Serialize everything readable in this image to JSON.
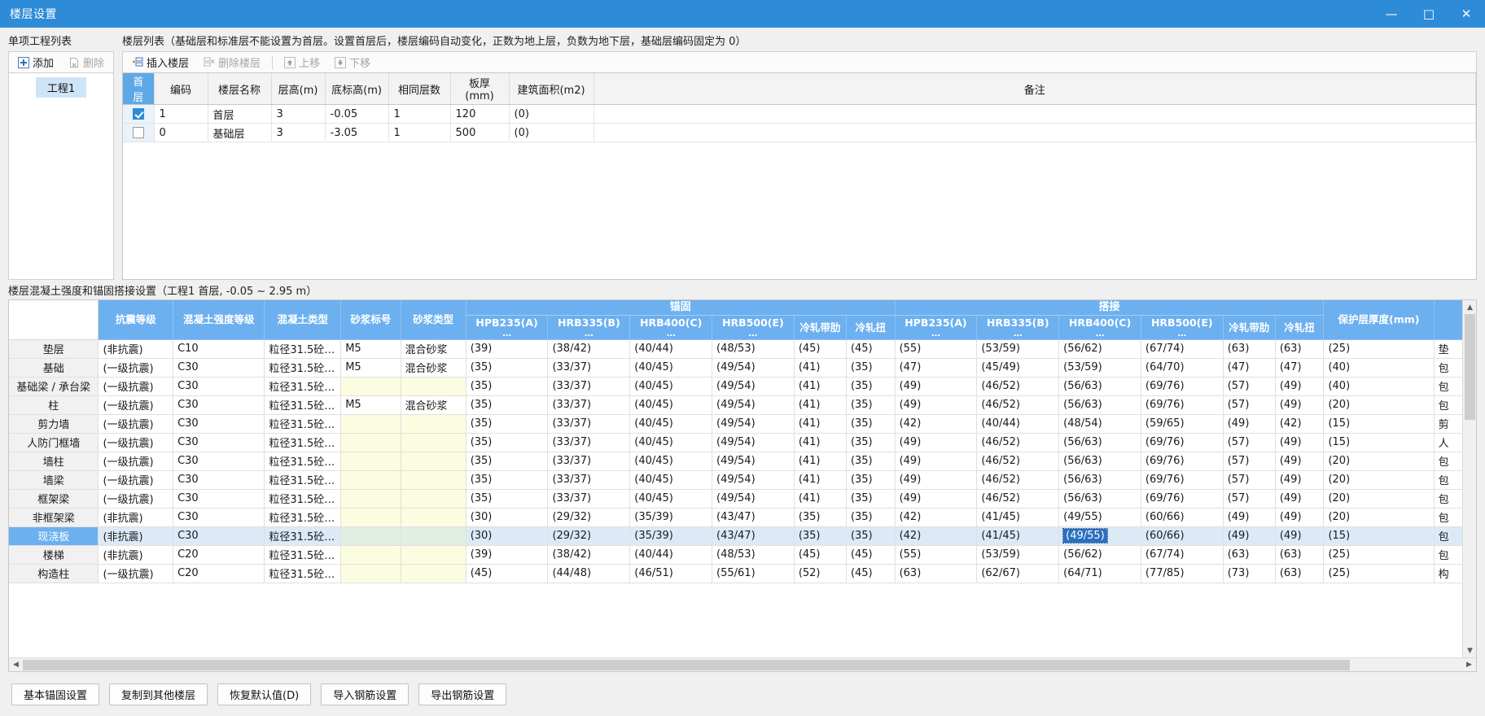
{
  "window": {
    "title": "楼层设置",
    "minimize": "—",
    "maximize": "□",
    "close": "✕"
  },
  "left_panel": {
    "label": "单项工程列表",
    "toolbar": {
      "add": "添加",
      "delete": "删除"
    },
    "items": [
      "工程1"
    ]
  },
  "floor_panel": {
    "label": "楼层列表（基础层和标准层不能设置为首层。设置首层后，楼层编码自动变化，正数为地上层，负数为地下层，基础层编码固定为 0）",
    "toolbar": {
      "insert": "插入楼层",
      "delete": "删除楼层",
      "move_up": "上移",
      "move_down": "下移"
    },
    "columns": [
      "首层",
      "编码",
      "楼层名称",
      "层高(m)",
      "底标高(m)",
      "相同层数",
      "板厚(mm)",
      "建筑面积(m2)",
      "备注"
    ],
    "rows": [
      {
        "checked": true,
        "code": "1",
        "name": "首层",
        "height": "3",
        "base_elev": "-0.05",
        "same_count": "1",
        "slab": "120",
        "area": "(0)",
        "note": ""
      },
      {
        "checked": false,
        "code": "0",
        "name": "基础层",
        "height": "3",
        "base_elev": "-3.05",
        "same_count": "1",
        "slab": "500",
        "area": "(0)",
        "note": ""
      }
    ]
  },
  "concrete_panel": {
    "label": "楼层混凝土强度和锚固搭接设置（工程1  首层, -0.05 ~ 2.95 m）",
    "group_headers": {
      "anchor": "锚固",
      "lap": "搭接"
    },
    "columns": [
      "抗震等级",
      "混凝土强度等级",
      "混凝土类型",
      "砂浆标号",
      "砂浆类型",
      "HPB235(A)\n…",
      "HRB335(B)\n…",
      "HRB400(C)\n…",
      "HRB500(E)\n…",
      "冷轧带肋",
      "冷轧扭",
      "HPB235(A)\n…",
      "HRB335(B)\n…",
      "HRB400(C)\n…",
      "HRB500(E)\n…",
      "冷轧带肋",
      "冷轧扭",
      "保护层厚度(mm)"
    ],
    "column_sub": "…",
    "rows": [
      {
        "name": "垫层",
        "seismic": "(非抗震)",
        "grade": "C10",
        "ctype": "粒径31.5砼…",
        "mortar_no": "M5",
        "mortar_type": "混合砂浆",
        "a": [
          "(39)",
          "(38/42)",
          "(40/44)",
          "(48/53)",
          "(45)",
          "(45)"
        ],
        "l": [
          "(55)",
          "(53/59)",
          "(56/62)",
          "(67/74)",
          "(63)",
          "(63)"
        ],
        "cover": "(25)",
        "last": "垫"
      },
      {
        "name": "基础",
        "seismic": "(一级抗震)",
        "grade": "C30",
        "ctype": "粒径31.5砼…",
        "mortar_no": "M5",
        "mortar_type": "混合砂浆",
        "a": [
          "(35)",
          "(33/37)",
          "(40/45)",
          "(49/54)",
          "(41)",
          "(35)"
        ],
        "l": [
          "(47)",
          "(45/49)",
          "(53/59)",
          "(64/70)",
          "(47)",
          "(47)"
        ],
        "cover": "(40)",
        "last": "包"
      },
      {
        "name": "基础梁 / 承台梁",
        "seismic": "(一级抗震)",
        "grade": "C30",
        "ctype": "粒径31.5砼…",
        "mortar_no": "",
        "mortar_type": "",
        "a": [
          "(35)",
          "(33/37)",
          "(40/45)",
          "(49/54)",
          "(41)",
          "(35)"
        ],
        "l": [
          "(49)",
          "(46/52)",
          "(56/63)",
          "(69/76)",
          "(57)",
          "(49)"
        ],
        "cover": "(40)",
        "last": "包"
      },
      {
        "name": "柱",
        "seismic": "(一级抗震)",
        "grade": "C30",
        "ctype": "粒径31.5砼…",
        "mortar_no": "M5",
        "mortar_type": "混合砂浆",
        "a": [
          "(35)",
          "(33/37)",
          "(40/45)",
          "(49/54)",
          "(41)",
          "(35)"
        ],
        "l": [
          "(49)",
          "(46/52)",
          "(56/63)",
          "(69/76)",
          "(57)",
          "(49)"
        ],
        "cover": "(20)",
        "last": "包"
      },
      {
        "name": "剪力墙",
        "seismic": "(一级抗震)",
        "grade": "C30",
        "ctype": "粒径31.5砼…",
        "mortar_no": "",
        "mortar_type": "",
        "a": [
          "(35)",
          "(33/37)",
          "(40/45)",
          "(49/54)",
          "(41)",
          "(35)"
        ],
        "l": [
          "(42)",
          "(40/44)",
          "(48/54)",
          "(59/65)",
          "(49)",
          "(42)"
        ],
        "cover": "(15)",
        "last": "剪"
      },
      {
        "name": "人防门框墙",
        "seismic": "(一级抗震)",
        "grade": "C30",
        "ctype": "粒径31.5砼…",
        "mortar_no": "",
        "mortar_type": "",
        "a": [
          "(35)",
          "(33/37)",
          "(40/45)",
          "(49/54)",
          "(41)",
          "(35)"
        ],
        "l": [
          "(49)",
          "(46/52)",
          "(56/63)",
          "(69/76)",
          "(57)",
          "(49)"
        ],
        "cover": "(15)",
        "last": "人"
      },
      {
        "name": "墙柱",
        "seismic": "(一级抗震)",
        "grade": "C30",
        "ctype": "粒径31.5砼…",
        "mortar_no": "",
        "mortar_type": "",
        "a": [
          "(35)",
          "(33/37)",
          "(40/45)",
          "(49/54)",
          "(41)",
          "(35)"
        ],
        "l": [
          "(49)",
          "(46/52)",
          "(56/63)",
          "(69/76)",
          "(57)",
          "(49)"
        ],
        "cover": "(20)",
        "last": "包"
      },
      {
        "name": "墙梁",
        "seismic": "(一级抗震)",
        "grade": "C30",
        "ctype": "粒径31.5砼…",
        "mortar_no": "",
        "mortar_type": "",
        "a": [
          "(35)",
          "(33/37)",
          "(40/45)",
          "(49/54)",
          "(41)",
          "(35)"
        ],
        "l": [
          "(49)",
          "(46/52)",
          "(56/63)",
          "(69/76)",
          "(57)",
          "(49)"
        ],
        "cover": "(20)",
        "last": "包"
      },
      {
        "name": "框架梁",
        "seismic": "(一级抗震)",
        "grade": "C30",
        "ctype": "粒径31.5砼…",
        "mortar_no": "",
        "mortar_type": "",
        "a": [
          "(35)",
          "(33/37)",
          "(40/45)",
          "(49/54)",
          "(41)",
          "(35)"
        ],
        "l": [
          "(49)",
          "(46/52)",
          "(56/63)",
          "(69/76)",
          "(57)",
          "(49)"
        ],
        "cover": "(20)",
        "last": "包"
      },
      {
        "name": "非框架梁",
        "seismic": "(非抗震)",
        "grade": "C30",
        "ctype": "粒径31.5砼…",
        "mortar_no": "",
        "mortar_type": "",
        "a": [
          "(30)",
          "(29/32)",
          "(35/39)",
          "(43/47)",
          "(35)",
          "(35)"
        ],
        "l": [
          "(42)",
          "(41/45)",
          "(49/55)",
          "(60/66)",
          "(49)",
          "(49)"
        ],
        "cover": "(20)",
        "last": "包"
      },
      {
        "name": "现浇板",
        "seismic": "(非抗震)",
        "grade": "C30",
        "ctype": "粒径31.5砼…",
        "mortar_no": "",
        "mortar_type": "",
        "a": [
          "(30)",
          "(29/32)",
          "(35/39)",
          "(43/47)",
          "(35)",
          "(35)"
        ],
        "l": [
          "(42)",
          "(41/45)",
          "(49/55)",
          "(60/66)",
          "(49)",
          "(49)"
        ],
        "cover": "(15)",
        "last": "包",
        "selected": true,
        "selected_cell_index": 2
      },
      {
        "name": "楼梯",
        "seismic": "(非抗震)",
        "grade": "C20",
        "ctype": "粒径31.5砼…",
        "mortar_no": "",
        "mortar_type": "",
        "a": [
          "(39)",
          "(38/42)",
          "(40/44)",
          "(48/53)",
          "(45)",
          "(45)"
        ],
        "l": [
          "(55)",
          "(53/59)",
          "(56/62)",
          "(67/74)",
          "(63)",
          "(63)"
        ],
        "cover": "(25)",
        "last": "包"
      },
      {
        "name": "构造柱",
        "seismic": "(一级抗震)",
        "grade": "C20",
        "ctype": "粒径31.5砼…",
        "mortar_no": "",
        "mortar_type": "",
        "a": [
          "(45)",
          "(44/48)",
          "(46/51)",
          "(55/61)",
          "(52)",
          "(45)"
        ],
        "l": [
          "(63)",
          "(62/67)",
          "(64/71)",
          "(77/85)",
          "(73)",
          "(63)"
        ],
        "cover": "(25)",
        "last": "构"
      }
    ]
  },
  "footer": {
    "buttons": [
      "基本锚固设置",
      "复制到其他楼层",
      "恢复默认值(D)",
      "导入钢筋设置",
      "导出钢筋设置"
    ]
  },
  "colors": {
    "titlebar": "#2e8bd8",
    "header_blue": "#6cb0ef",
    "selection": "#dceaf8",
    "cell_selection": "#2a6fc0",
    "yellow_cell": "#fcfce0"
  }
}
